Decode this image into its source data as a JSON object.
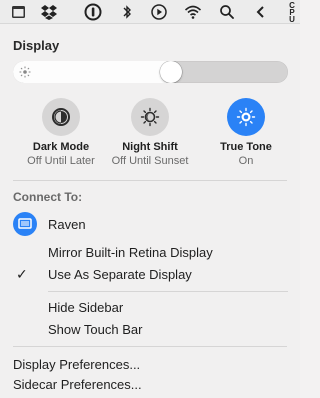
{
  "menubar": {
    "icons": [
      "calendar-icon",
      "dropbox-icon",
      "onepassword-icon",
      "bluetooth-icon",
      "play-icon",
      "wifi-icon",
      "search-icon",
      "back-arrow-icon"
    ],
    "cpu_label": "CPU"
  },
  "display": {
    "title": "Display",
    "brightness": 0.58
  },
  "tiles": [
    {
      "name": "Dark Mode",
      "status": "Off Until Later",
      "icon": "dark-mode-icon",
      "active": false
    },
    {
      "name": "Night Shift",
      "status": "Off Until Sunset",
      "icon": "night-shift-icon",
      "active": false
    },
    {
      "name": "True Tone",
      "status": "On",
      "icon": "true-tone-icon",
      "active": true
    }
  ],
  "connect": {
    "title": "Connect To:",
    "device": "Raven",
    "device_icon": "display-icon"
  },
  "options": {
    "mirror": "Mirror Built-in Retina Display",
    "separate": "Use As Separate Display",
    "check": "✓"
  },
  "sidebar": {
    "hide_sidebar": "Hide Sidebar",
    "show_touch_bar": "Show Touch Bar"
  },
  "prefs": {
    "display": "Display Preferences...",
    "sidecar": "Sidecar Preferences..."
  },
  "colors": {
    "accent": "#2a82f6",
    "panel": "#f1f0f0",
    "tile_bg": "#d6d5d5"
  }
}
